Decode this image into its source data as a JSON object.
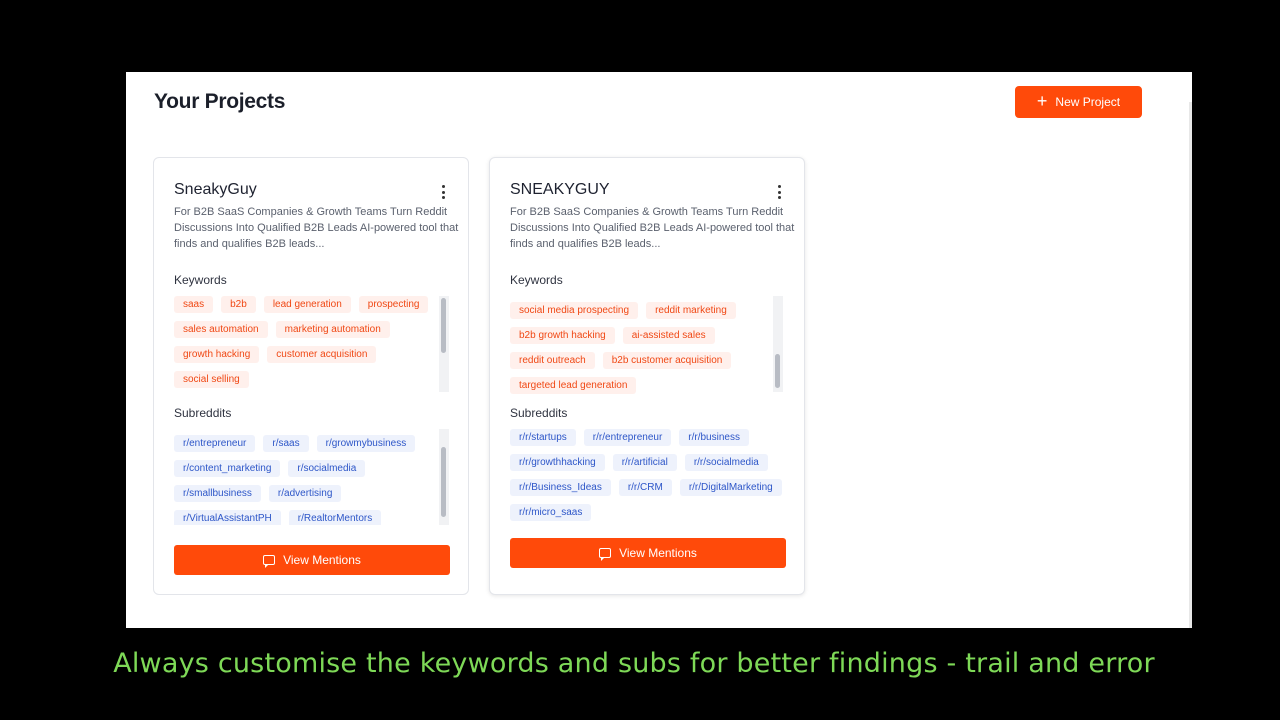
{
  "header": {
    "title": "Your Projects",
    "new_project_label": "New Project"
  },
  "projects": [
    {
      "name": "SneakyGuy",
      "description": "For B2B SaaS Companies & Growth Teams Turn Reddit Discussions Into Qualified B2B Leads AI-powered tool that finds and qualifies B2B leads...",
      "keywords_label": "Keywords",
      "keywords": [
        "saas",
        "b2b",
        "lead generation",
        "prospecting",
        "sales automation",
        "marketing automation",
        "growth hacking",
        "customer acquisition",
        "social selling"
      ],
      "subreddits_label": "Subreddits",
      "subreddits": [
        "r/entrepreneur",
        "r/saas",
        "r/growmybusiness",
        "r/content_marketing",
        "r/socialmedia",
        "r/smallbusiness",
        "r/advertising",
        "r/VirtualAssistantPH",
        "r/RealtorMentors"
      ],
      "view_label": "View Mentions"
    },
    {
      "name": "SNEAKYGUY",
      "description": "For B2B SaaS Companies & Growth Teams Turn Reddit Discussions Into Qualified B2B Leads AI-powered tool that finds and qualifies B2B leads...",
      "keywords_label": "Keywords",
      "keywords": [
        "social media prospecting",
        "reddit marketing",
        "b2b growth hacking",
        "ai-assisted sales",
        "reddit outreach",
        "b2b customer acquisition",
        "targeted lead generation"
      ],
      "subreddits_label": "Subreddits",
      "subreddits": [
        "r/r/startups",
        "r/r/entrepreneur",
        "r/r/business",
        "r/r/growthhacking",
        "r/r/artificial",
        "r/r/socialmedia",
        "r/r/Business_Ideas",
        "r/r/CRM",
        "r/r/DigitalMarketing",
        "r/r/micro_saas"
      ],
      "view_label": "View Mentions"
    }
  ],
  "caption": "Always customise the keywords and subs for better findings - trail and error",
  "colors": {
    "accent": "#ff4a0a",
    "keyword_text": "#f04814",
    "keyword_bg": "#fff0ec",
    "sub_text": "#2d56c8",
    "sub_bg": "#eef2fc",
    "caption": "#7ed957"
  }
}
